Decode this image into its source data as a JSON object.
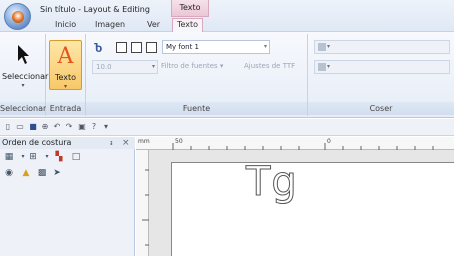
{
  "window": {
    "title": "Sin título - Layout & Editing",
    "context_tab_group": "Texto"
  },
  "tabs": [
    "Inicio",
    "Imagen",
    "Ver",
    "Texto"
  ],
  "ribbon": {
    "select_group": {
      "button_label": "Seleccionar",
      "group_label": "Seleccionar"
    },
    "entrada_group": {
      "button_label": "Texto",
      "group_label": "Entrada"
    },
    "fuente_group": {
      "font_name": "My font 1",
      "font_size": "10.0",
      "filter_label": "Filtro de fuentes",
      "ttf_label": "Ajustes de TTF",
      "group_label": "Fuente"
    },
    "coser_group": {
      "group_label": "Coser"
    }
  },
  "left_pane": {
    "title": "Orden de costura",
    "pin_glyph": "ᵻ",
    "close_glyph": "×"
  },
  "rulers": {
    "unit": "mm",
    "top_mark_1": "50",
    "top_mark_2": "0"
  },
  "canvas": {
    "sample_text": "Tg"
  }
}
